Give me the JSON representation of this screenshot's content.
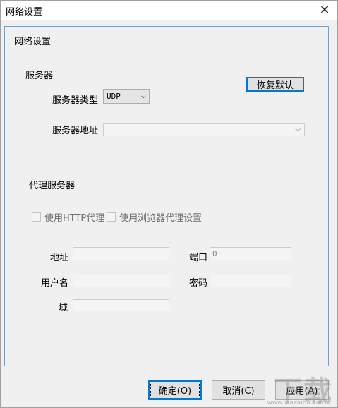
{
  "window": {
    "title": "网络设置"
  },
  "panel": {
    "title": "网络设置"
  },
  "server": {
    "group_label": "服务器",
    "restore_default_label": "恢复默认",
    "type_label": "服务器类型",
    "type_value": "UDP",
    "address_label": "服务器地址",
    "address_value": ""
  },
  "proxy": {
    "group_label": "代理服务器",
    "use_http_label": "使用HTTP代理",
    "use_browser_label": "使用浏览器代理设置",
    "address_label": "地址",
    "address_value": "",
    "port_label": "端口",
    "port_value": "0",
    "username_label": "用户名",
    "username_value": "",
    "password_label": "密码",
    "password_value": "",
    "domain_label": "域",
    "domain_value": ""
  },
  "footer": {
    "ok_label": "确定(O)",
    "cancel_label": "取消(C)",
    "apply_label": "应用(A)"
  },
  "watermark": {
    "main": "下载",
    "sub": "www.xiazaiba.com"
  }
}
